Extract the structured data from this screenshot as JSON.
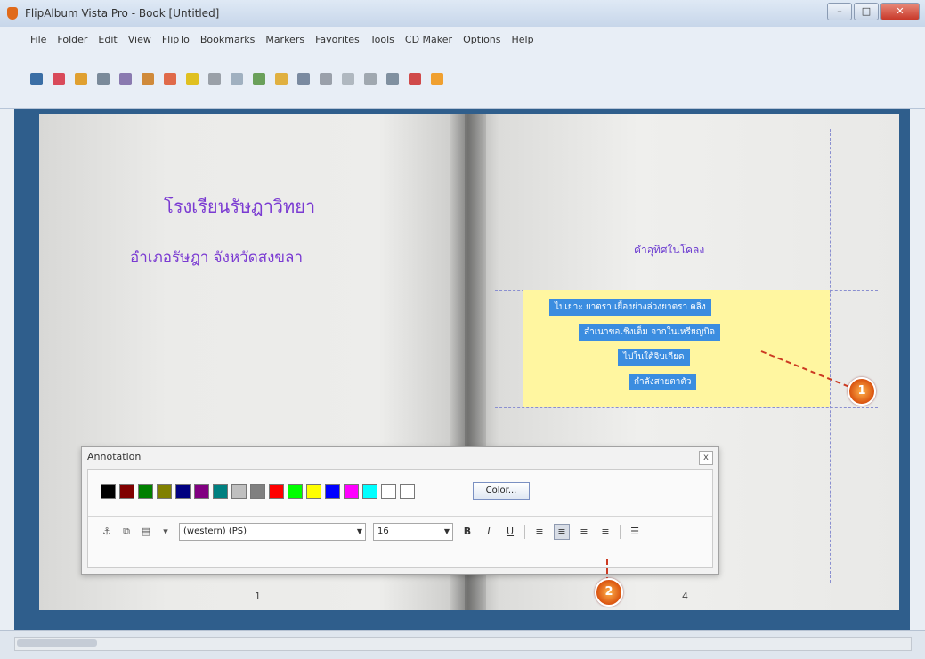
{
  "window": {
    "title": "FlipAlbum Vista Pro - Book [Untitled]",
    "buttons": [
      "–",
      "□",
      "✕"
    ]
  },
  "menu": [
    "File",
    "Folder",
    "Edit",
    "View",
    "FlipTo",
    "Bookmarks",
    "Markers",
    "Favorites",
    "Tools",
    "CD Maker",
    "Options",
    "Help"
  ],
  "toolbar_icons": [
    {
      "name": "new-book-icon",
      "color": "#3a6ea5"
    },
    {
      "name": "open-icon",
      "color": "#d94a5a"
    },
    {
      "name": "save-icon",
      "color": "#e0a030"
    },
    {
      "name": "print-icon",
      "color": "#7a8a9a"
    },
    {
      "name": "cut-icon",
      "color": "#8a7ab0"
    },
    {
      "name": "copy-icon",
      "color": "#d08a3a"
    },
    {
      "name": "paste-icon",
      "color": "#e06a4a"
    },
    {
      "name": "star-icon",
      "color": "#e0c020"
    },
    {
      "name": "undo-icon",
      "color": "#9aa0a8"
    },
    {
      "name": "flip-left-icon",
      "color": "#a0b0c0"
    },
    {
      "name": "flip-right-icon",
      "color": "#6aa05a"
    },
    {
      "name": "music-icon",
      "color": "#e0b040"
    },
    {
      "name": "bookmark-icon",
      "color": "#7a8aa0"
    },
    {
      "name": "marker-icon",
      "color": "#9aa0aa"
    },
    {
      "name": "cd-icon",
      "color": "#b0b8c0"
    },
    {
      "name": "tools-icon",
      "color": "#a0a8b0"
    },
    {
      "name": "options-icon",
      "color": "#8090a0"
    },
    {
      "name": "help-icon",
      "color": "#d04a4a"
    },
    {
      "name": "info-icon",
      "color": "#f0a030"
    }
  ],
  "left_page": {
    "title": "โรงเรียนรัษฎาวิทยา",
    "subtitle": "อำเภอรัษฎา   จังหวัดสงขลา",
    "page_number": "1"
  },
  "right_page": {
    "heading": "คำอุทิศในโคลง",
    "note_lines": [
      "ไปเยาะ ยาตรา   เยื้องย่างล่วงยาตรา ตลิ่ง",
      "สำเนาขอเชิงเต็ม จากในเหรียญบิด",
      "ไปในใต้จิบเกียด",
      "กำลังสายตาตัว"
    ],
    "page_number": "4"
  },
  "markers": {
    "text_marker": "1",
    "align_marker": "2"
  },
  "annotation": {
    "title": "Annotation",
    "close": "x",
    "colors": [
      "#000000",
      "#800000",
      "#008000",
      "#808000",
      "#000080",
      "#800080",
      "#008080",
      "#c0c0c0",
      "#808080",
      "#ff0000",
      "#00ff00",
      "#ffff00",
      "#0000ff",
      "#ff00ff",
      "#00ffff",
      "#ffffff",
      "#ffffff"
    ],
    "color_button": "Color...",
    "font_name": "(western) (PS)",
    "font_size": "16",
    "format_buttons": [
      "B",
      "I",
      "U",
      "≡",
      "≡",
      "≡",
      "≡"
    ]
  }
}
